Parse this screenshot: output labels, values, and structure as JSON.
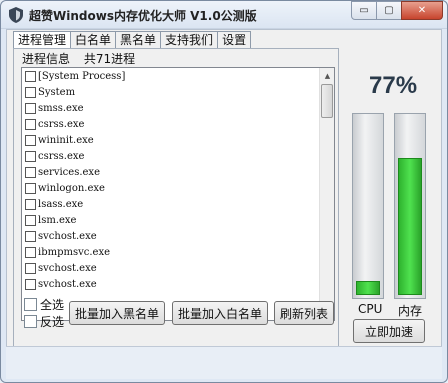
{
  "window": {
    "title": "超赞Windows内存优化大师  V1.0公测版",
    "controls": {
      "minimize": "▭",
      "maximize": "▢",
      "close": "✕"
    }
  },
  "tabs": [
    "进程管理",
    "白名单",
    "黑名单",
    "支持我们",
    "设置"
  ],
  "process_panel": {
    "info_label": "进程信息",
    "count_label": "共71进程",
    "processes": [
      "[System Process]",
      "System",
      "smss.exe",
      "csrss.exe",
      "wininit.exe",
      "csrss.exe",
      "services.exe",
      "winlogon.exe",
      "lsass.exe",
      "lsm.exe",
      "svchost.exe",
      "ibmpmsvc.exe",
      "svchost.exe",
      "svchost.exe"
    ],
    "select_all": "全选",
    "invert_select": "反选",
    "buttons": {
      "add_blacklist": "批量加入黑名单",
      "add_whitelist": "批量加入白名单",
      "refresh": "刷新列表"
    }
  },
  "memory": {
    "percent": "77%",
    "cpu_label": "CPU",
    "mem_label": "内存",
    "cpu_level": 0.08,
    "mem_level": 0.77,
    "speedup_button": "立即加速"
  },
  "colors": {
    "gauge_fill": "#3cc83c",
    "accent": "#2a3a4a"
  }
}
